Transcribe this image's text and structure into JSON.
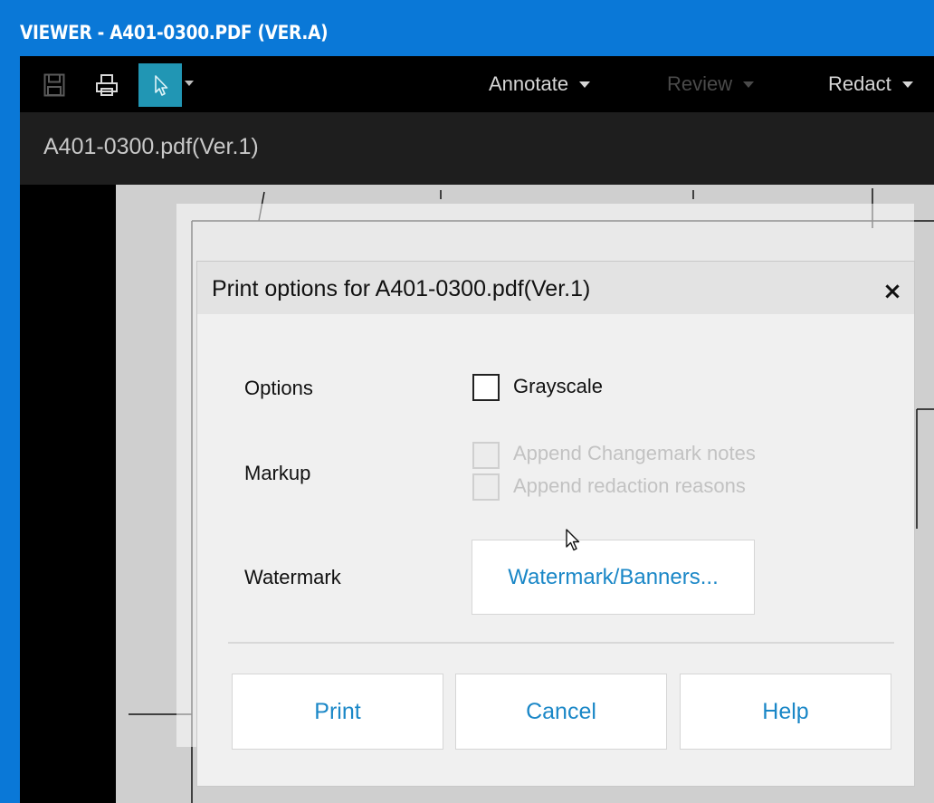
{
  "window": {
    "title": "VIEWER - A401-0300.PDF (VER.A)"
  },
  "toolbar": {
    "icons": [
      "save-icon",
      "print-icon",
      "select-pointer-icon"
    ],
    "menus": [
      {
        "label": "Annotate",
        "enabled": true
      },
      {
        "label": "Review",
        "enabled": false
      },
      {
        "label": "Redact",
        "enabled": true
      }
    ]
  },
  "document": {
    "title": "A401-0300.pdf(Ver.1)"
  },
  "dialog": {
    "title": "Print options for A401-0300.pdf(Ver.1)",
    "close_icon": "close-icon",
    "close_glyph": "×",
    "options": {
      "label": "Options",
      "grayscale": {
        "label": "Grayscale",
        "checked": false,
        "enabled": true
      }
    },
    "markup": {
      "label": "Markup",
      "append_changemark": {
        "label": "Append Changemark notes",
        "checked": false,
        "enabled": false
      },
      "append_redaction": {
        "label": "Append redaction reasons",
        "checked": false,
        "enabled": false
      }
    },
    "watermark": {
      "label": "Watermark",
      "button_label": "Watermark/Banners..."
    },
    "buttons": {
      "print": "Print",
      "cancel": "Cancel",
      "help": "Help"
    }
  },
  "colors": {
    "titlebar": "#0a78d7",
    "accent_link": "#1a87c7",
    "active_tool": "#2196b4"
  }
}
